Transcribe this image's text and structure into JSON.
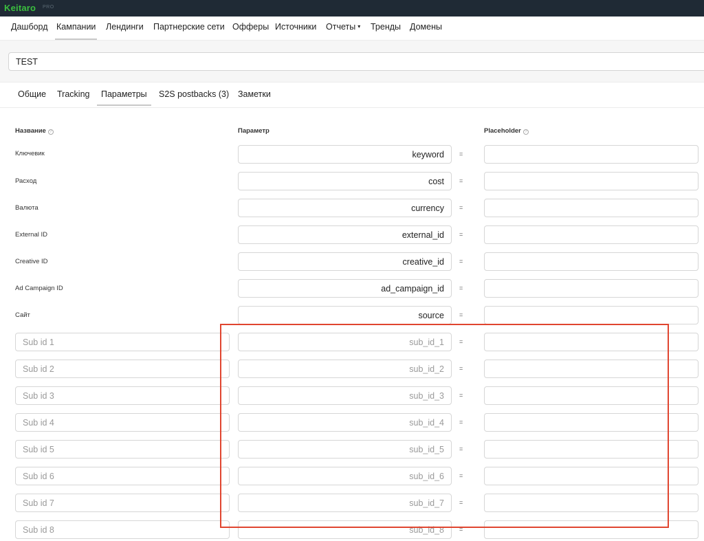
{
  "app": {
    "logo": "Keitaro",
    "badge": "PRO"
  },
  "nav": [
    {
      "label": "Дашборд"
    },
    {
      "label": "Кампании"
    },
    {
      "label": "Лендинги"
    },
    {
      "label": "Партнерские сети"
    },
    {
      "label": "Офферы"
    },
    {
      "label": "Источники"
    },
    {
      "label": "Отчеты",
      "caret": "▾"
    },
    {
      "label": "Тренды"
    },
    {
      "label": "Домены"
    }
  ],
  "campaign": {
    "name": "TEST"
  },
  "tabs": [
    {
      "label": "Общие"
    },
    {
      "label": "Tracking"
    },
    {
      "label": "Параметры"
    },
    {
      "label": "S2S postbacks (3)"
    },
    {
      "label": "Заметки"
    }
  ],
  "columns": {
    "name": "Название",
    "param": "Параметр",
    "placeholder": "Placeholder",
    "info_glyph": "?"
  },
  "equals": "=",
  "rows": [
    {
      "label": "Ключевик",
      "param": "keyword",
      "placeholder": ""
    },
    {
      "label": "Расход",
      "param": "cost",
      "placeholder": ""
    },
    {
      "label": "Валюта",
      "param": "currency",
      "placeholder": ""
    },
    {
      "label": "External ID",
      "param": "external_id",
      "placeholder": ""
    },
    {
      "label": "Creative ID",
      "param": "creative_id",
      "placeholder": ""
    },
    {
      "label": "Ad Campaign ID",
      "param": "ad_campaign_id",
      "placeholder": ""
    },
    {
      "label": "Сайт",
      "param": "source",
      "placeholder": ""
    }
  ],
  "sub_rows": [
    {
      "name_placeholder": "Sub id 1",
      "param_placeholder": "sub_id_1"
    },
    {
      "name_placeholder": "Sub id 2",
      "param_placeholder": "sub_id_2"
    },
    {
      "name_placeholder": "Sub id 3",
      "param_placeholder": "sub_id_3"
    },
    {
      "name_placeholder": "Sub id 4",
      "param_placeholder": "sub_id_4"
    },
    {
      "name_placeholder": "Sub id 5",
      "param_placeholder": "sub_id_5"
    },
    {
      "name_placeholder": "Sub id 6",
      "param_placeholder": "sub_id_6"
    },
    {
      "name_placeholder": "Sub id 7",
      "param_placeholder": "sub_id_7"
    },
    {
      "name_placeholder": "Sub id 8",
      "param_placeholder": "sub_id_8"
    }
  ],
  "colors": {
    "topbar": "#1f2a35",
    "logo": "#3bbf3f",
    "highlight": "#e0452f"
  }
}
